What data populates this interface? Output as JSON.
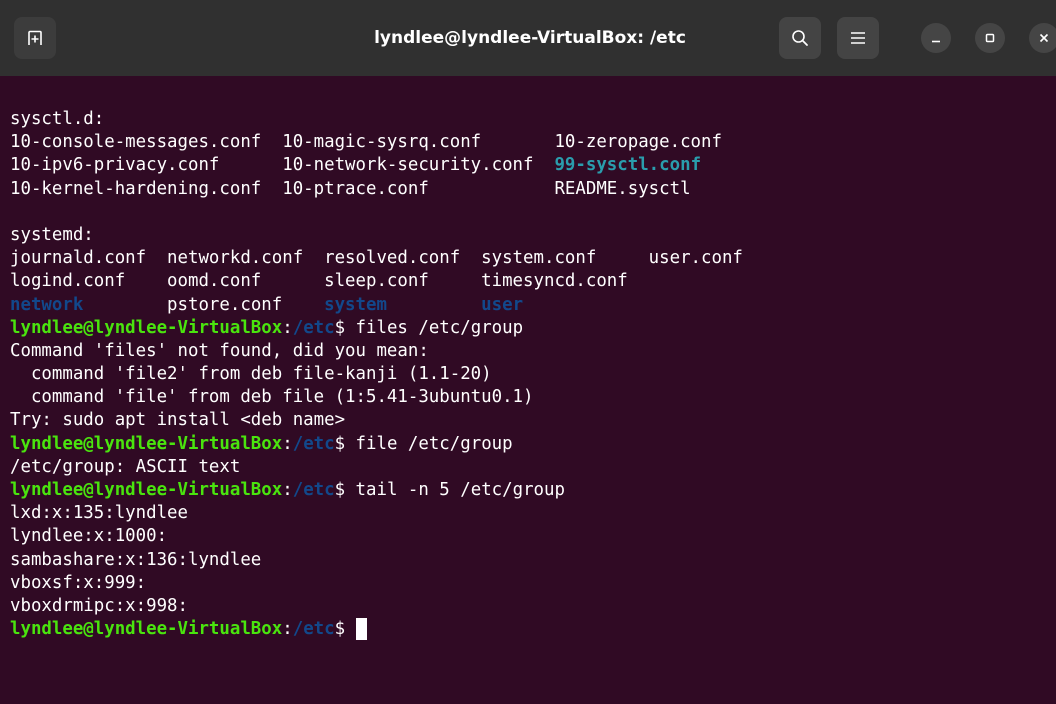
{
  "window": {
    "title": "lyndlee@lyndlee-VirtualBox: /etc"
  },
  "colors": {
    "background": "#300a24",
    "titlebar": "#303030",
    "text": "#ffffff",
    "prompt_user": "#4ae40e",
    "prompt_path": "#12488b",
    "dir": "#12488b",
    "symlink": "#2a9dad"
  },
  "icons": {
    "new_tab": "new-tab-icon",
    "search": "search-icon",
    "menu": "hamburger-menu-icon",
    "minimize": "minimize-icon",
    "maximize": "maximize-icon",
    "close": "close-icon"
  },
  "terminal": {
    "lines": [
      {
        "kind": "output",
        "segments": [
          {
            "t": "sysctl.d:",
            "c": "#ffffff",
            "b": false
          }
        ]
      },
      {
        "kind": "output",
        "segments": [
          {
            "t": "10-console-messages.conf  10-magic-sysrq.conf       10-zeropage.conf",
            "c": "#ffffff",
            "b": false
          }
        ]
      },
      {
        "kind": "output",
        "segments": [
          {
            "t": "10-ipv6-privacy.conf      10-network-security.conf  ",
            "c": "#ffffff",
            "b": false
          },
          {
            "t": "99-sysctl.conf",
            "c": "#2a9dad",
            "b": true
          }
        ]
      },
      {
        "kind": "output",
        "segments": [
          {
            "t": "10-kernel-hardening.conf  10-ptrace.conf            README.sysctl",
            "c": "#ffffff",
            "b": false
          }
        ]
      },
      {
        "kind": "blank",
        "segments": [
          {
            "t": "",
            "c": "#ffffff",
            "b": false
          }
        ]
      },
      {
        "kind": "output",
        "segments": [
          {
            "t": "systemd:",
            "c": "#ffffff",
            "b": false
          }
        ]
      },
      {
        "kind": "output",
        "segments": [
          {
            "t": "journald.conf  networkd.conf  resolved.conf  system.conf     user.conf",
            "c": "#ffffff",
            "b": false
          }
        ]
      },
      {
        "kind": "output",
        "segments": [
          {
            "t": "logind.conf    oomd.conf      sleep.conf     timesyncd.conf",
            "c": "#ffffff",
            "b": false
          }
        ]
      },
      {
        "kind": "output",
        "segments": [
          {
            "t": "network",
            "c": "#12488b",
            "b": true
          },
          {
            "t": "        pstore.conf    ",
            "c": "#ffffff",
            "b": false
          },
          {
            "t": "system",
            "c": "#12488b",
            "b": true
          },
          {
            "t": "         ",
            "c": "#ffffff",
            "b": false
          },
          {
            "t": "user",
            "c": "#12488b",
            "b": true
          }
        ]
      },
      {
        "kind": "prompt",
        "segments": [
          {
            "t": "lyndlee@lyndlee-VirtualBox",
            "c": "#4ae40e",
            "b": true
          },
          {
            "t": ":",
            "c": "#ffffff",
            "b": false
          },
          {
            "t": "/etc",
            "c": "#12488b",
            "b": true
          },
          {
            "t": "$ files /etc/group",
            "c": "#ffffff",
            "b": false
          }
        ]
      },
      {
        "kind": "output",
        "segments": [
          {
            "t": "Command 'files' not found, did you mean:",
            "c": "#ffffff",
            "b": false
          }
        ]
      },
      {
        "kind": "output",
        "segments": [
          {
            "t": "  command 'file2' from deb file-kanji (1.1-20)",
            "c": "#ffffff",
            "b": false
          }
        ]
      },
      {
        "kind": "output",
        "segments": [
          {
            "t": "  command 'file' from deb file (1:5.41-3ubuntu0.1)",
            "c": "#ffffff",
            "b": false
          }
        ]
      },
      {
        "kind": "output",
        "segments": [
          {
            "t": "Try: sudo apt install <deb name>",
            "c": "#ffffff",
            "b": false
          }
        ]
      },
      {
        "kind": "prompt",
        "segments": [
          {
            "t": "lyndlee@lyndlee-VirtualBox",
            "c": "#4ae40e",
            "b": true
          },
          {
            "t": ":",
            "c": "#ffffff",
            "b": false
          },
          {
            "t": "/etc",
            "c": "#12488b",
            "b": true
          },
          {
            "t": "$ file /etc/group",
            "c": "#ffffff",
            "b": false
          }
        ]
      },
      {
        "kind": "output",
        "segments": [
          {
            "t": "/etc/group: ASCII text",
            "c": "#ffffff",
            "b": false
          }
        ]
      },
      {
        "kind": "prompt",
        "segments": [
          {
            "t": "lyndlee@lyndlee-VirtualBox",
            "c": "#4ae40e",
            "b": true
          },
          {
            "t": ":",
            "c": "#ffffff",
            "b": false
          },
          {
            "t": "/etc",
            "c": "#12488b",
            "b": true
          },
          {
            "t": "$ tail -n 5 /etc/group",
            "c": "#ffffff",
            "b": false
          }
        ]
      },
      {
        "kind": "output",
        "segments": [
          {
            "t": "lxd:x:135:lyndlee",
            "c": "#ffffff",
            "b": false
          }
        ]
      },
      {
        "kind": "output",
        "segments": [
          {
            "t": "lyndlee:x:1000:",
            "c": "#ffffff",
            "b": false
          }
        ]
      },
      {
        "kind": "output",
        "segments": [
          {
            "t": "sambashare:x:136:lyndlee",
            "c": "#ffffff",
            "b": false
          }
        ]
      },
      {
        "kind": "output",
        "segments": [
          {
            "t": "vboxsf:x:999:",
            "c": "#ffffff",
            "b": false
          }
        ]
      },
      {
        "kind": "output",
        "segments": [
          {
            "t": "vboxdrmipc:x:998:",
            "c": "#ffffff",
            "b": false
          }
        ]
      },
      {
        "kind": "prompt-current",
        "segments": [
          {
            "t": "lyndlee@lyndlee-VirtualBox",
            "c": "#4ae40e",
            "b": true
          },
          {
            "t": ":",
            "c": "#ffffff",
            "b": false
          },
          {
            "t": "/etc",
            "c": "#12488b",
            "b": true
          },
          {
            "t": "$ ",
            "c": "#ffffff",
            "b": false
          }
        ]
      }
    ]
  }
}
